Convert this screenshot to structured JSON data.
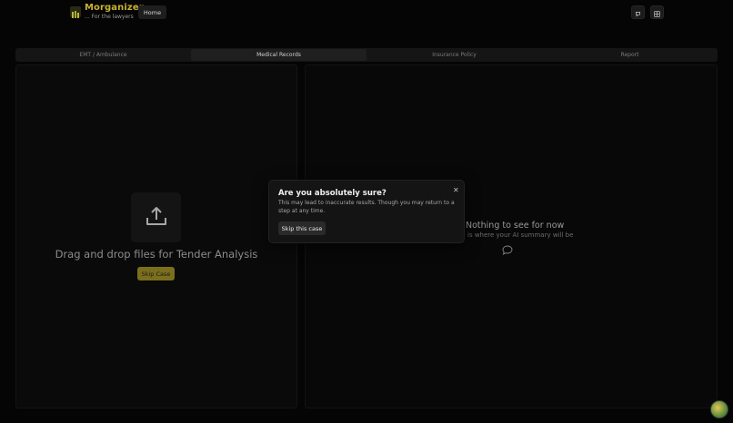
{
  "app": {
    "brand_title": "Morganizer",
    "brand_subtitle": "... For the lawyers",
    "logo_icon": "logo-icon"
  },
  "header": {
    "home_label": "Home",
    "icons": [
      "chat-icon",
      "grid-icon"
    ]
  },
  "tabs": [
    {
      "label": "EMT / Ambulance",
      "active": false
    },
    {
      "label": "Medical Records",
      "active": true
    },
    {
      "label": "Insurance Policy",
      "active": false
    },
    {
      "label": "Report",
      "active": false
    }
  ],
  "left_panel": {
    "upload_icon": "upload-icon",
    "drop_text": "Drag and drop files for Tender Analysis",
    "skip_label": "Skip Case"
  },
  "right_panel": {
    "empty_title": "Nothing to see for now",
    "empty_subtitle": "is where your AI summary will be",
    "empty_icon": "chat-bubble-icon"
  },
  "dialog": {
    "title": "Are you absolutely sure?",
    "description": "This may lead to inaccurate results. Though you may return to a step at any time.",
    "confirm_label": "Skip this case",
    "close_icon": "close-icon"
  },
  "colors": {
    "brand": "#c9b230",
    "accent_button": "#7b6f1d",
    "background": "#050505"
  }
}
